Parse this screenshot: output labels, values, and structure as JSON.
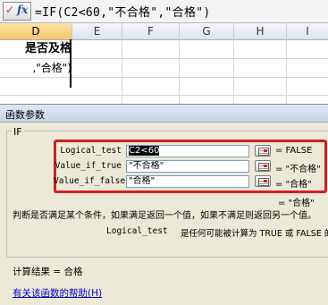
{
  "formula_bar": {
    "fx_label": "fx",
    "formula": "=IF(C2<60,\"不合格\",\"合格\")"
  },
  "sheet": {
    "columns": [
      "D",
      "E",
      "F",
      "G",
      "H",
      "I"
    ],
    "selected_column": "D",
    "cells": {
      "d1": "是否及格",
      "d2": ",\"合格\")"
    }
  },
  "dialog": {
    "title": "函数参数",
    "function_name": "IF",
    "args": [
      {
        "label": "Logical_test",
        "value": "C2<60",
        "result": "=  FALSE"
      },
      {
        "label": "Value_if_true",
        "value": "\"不合格\"",
        "result": "=  \"不合格\""
      },
      {
        "label": "Value_if_false",
        "value": "\"合格\"",
        "result": "=  \"合格\""
      }
    ],
    "extra_result": "=  \"合格\"",
    "description": "判断是否满足某个条件，如果满足返回一个值，如果不满足则返回另一个值。",
    "arg_description_name": "Logical_test",
    "arg_description_text": "是任何可能被计算为 TRUE 或 FALSE 的数",
    "calc_result_label": "计算结果 =  合格",
    "help_link": "有关该函数的帮助(H)"
  },
  "colors": {
    "highlight_border": "#d21f1f",
    "dialog_bg": "#ece9d8",
    "link": "#0000cc",
    "selected_column_header": "#f5c56b"
  },
  "icons": {
    "fx": "function-icon",
    "ref": "range-select-icon"
  }
}
